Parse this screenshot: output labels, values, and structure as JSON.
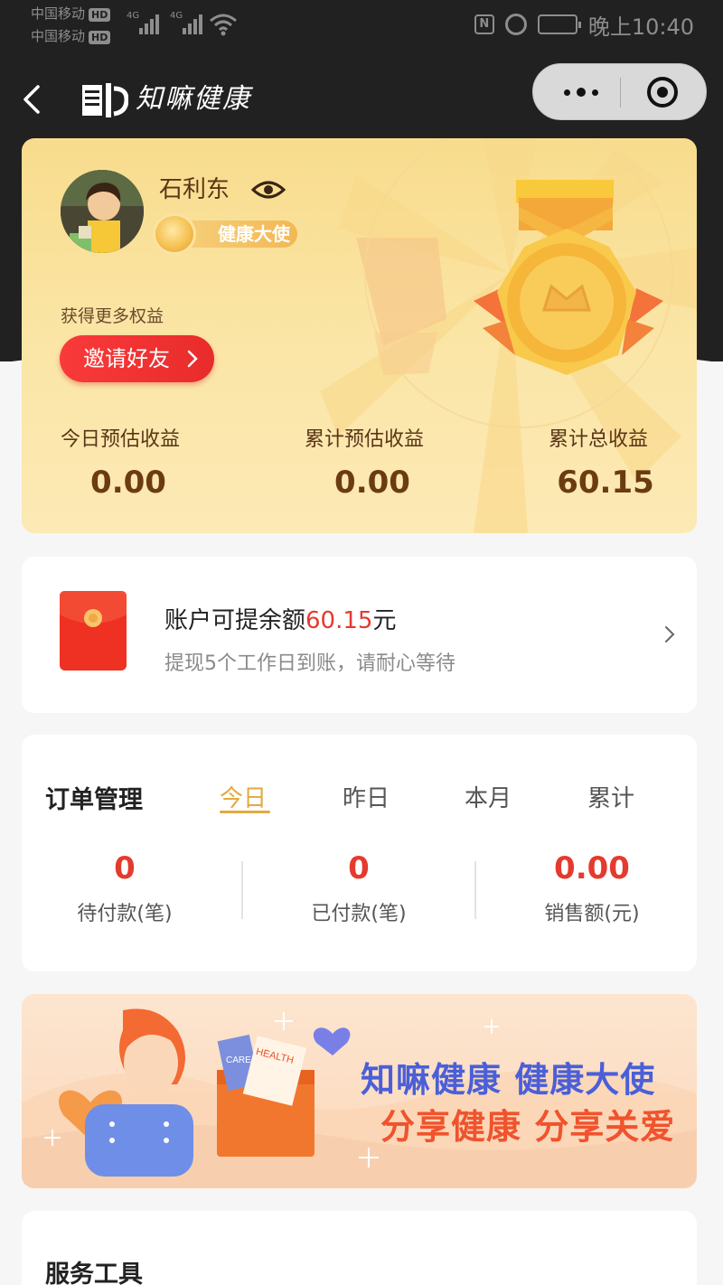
{
  "status_bar": {
    "carrier_1": "中国移动",
    "carrier_2": "中国移动",
    "hd": "HD",
    "signal_type": "4G",
    "time": "晚上10:40",
    "icons": [
      "signal-icon",
      "wifi-icon",
      "nfc-icon",
      "alarm-icon",
      "battery-icon"
    ]
  },
  "nav": {
    "app_title": "知嘛健康",
    "icons": [
      "back-icon",
      "more-icon",
      "close-icon"
    ]
  },
  "profile": {
    "name": "石利东",
    "badge": "健康大使",
    "more_benefits": "获得更多权益",
    "invite_button": "邀请好友"
  },
  "earnings": {
    "today_label": "今日预估收益",
    "today_value": "0.00",
    "cumulative_est_label": "累计预估收益",
    "cumulative_est_value": "0.00",
    "total_label": "累计总收益",
    "total_value": "60.15"
  },
  "balance": {
    "title_prefix": "账户可提余额",
    "amount": "60.15",
    "unit": "元",
    "subtitle": "提现5个工作日到账，请耐心等待"
  },
  "orders": {
    "title": "订单管理",
    "tabs": [
      "今日",
      "昨日",
      "本月",
      "累计"
    ],
    "active_tab": "今日",
    "stats": [
      {
        "value": "0",
        "label": "待付款(笔)"
      },
      {
        "value": "0",
        "label": "已付款(笔)"
      },
      {
        "value": "0.00",
        "label": "销售额(元)"
      }
    ]
  },
  "banner": {
    "line1": "知嘛健康 健康大使",
    "line2": "分享健康 分享关爱",
    "card_label": "CARE",
    "doc_label": "HEALTH"
  },
  "tools": {
    "title": "服务工具"
  },
  "colors": {
    "header_bg": "#212121",
    "accent_red": "#e53a2e",
    "accent_gold": "#e2a93e",
    "banner_blue": "#4a5fd8",
    "banner_orange": "#f0532d"
  }
}
